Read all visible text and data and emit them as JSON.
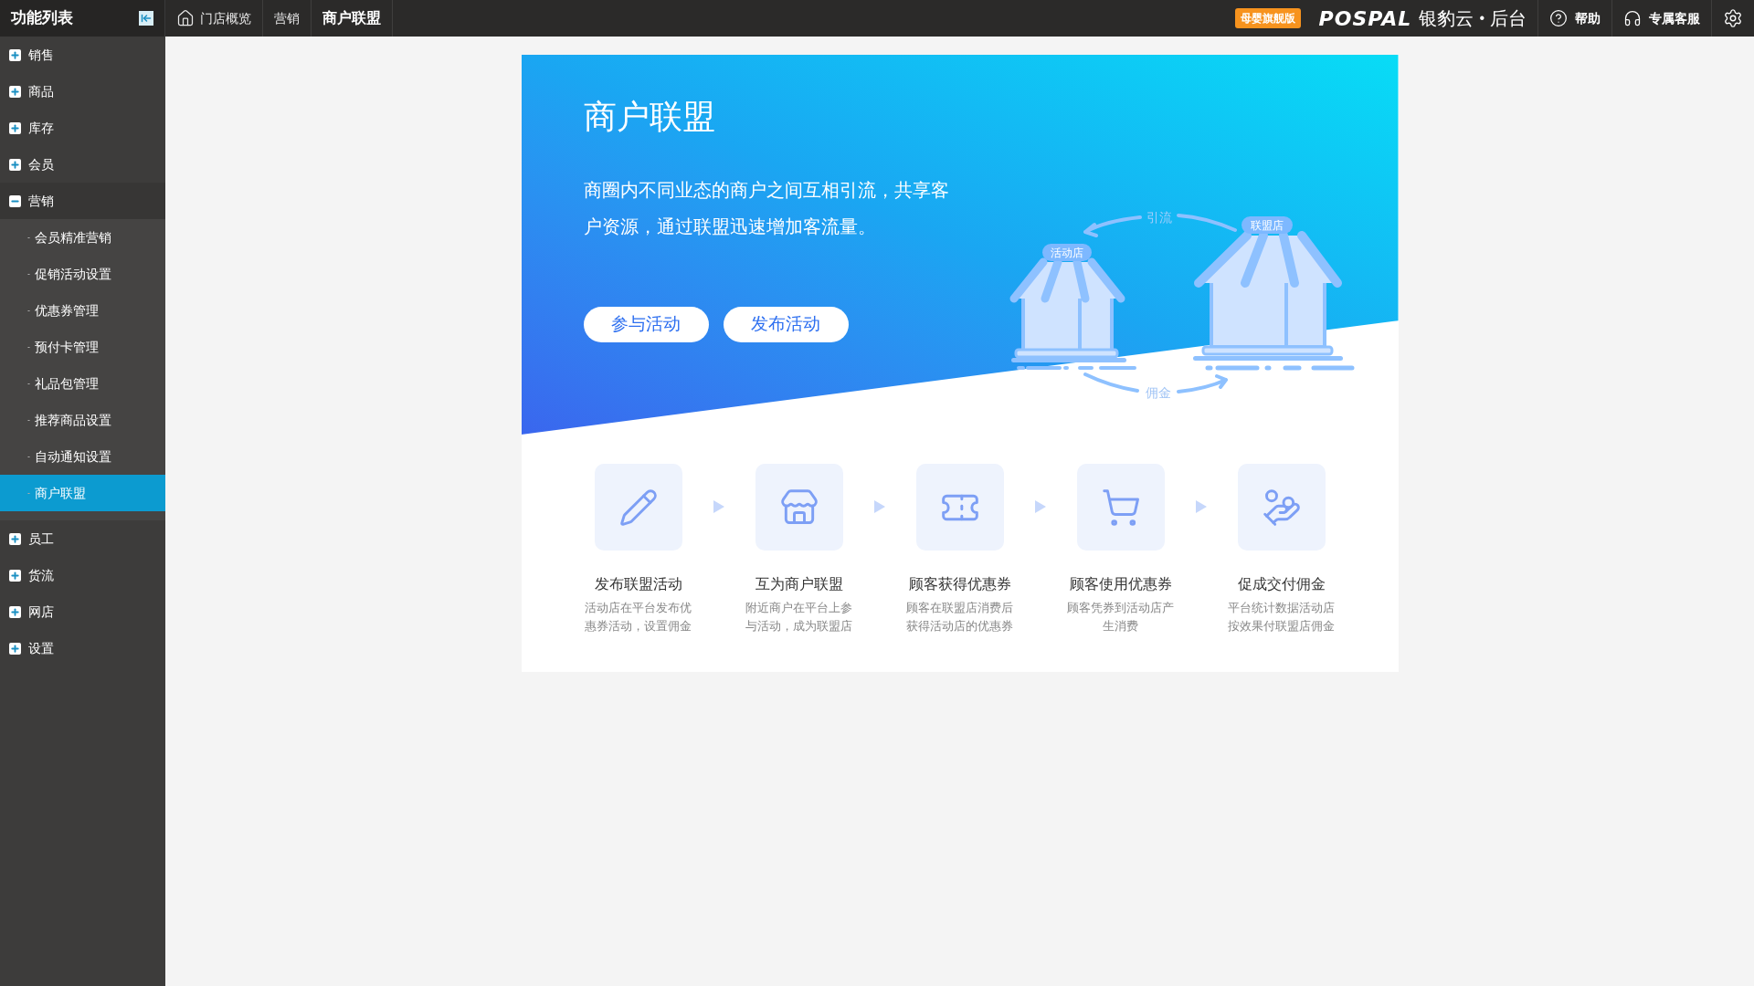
{
  "sidebar": {
    "title": "功能列表",
    "items": [
      {
        "label": "销售",
        "expanded": false
      },
      {
        "label": "商品",
        "expanded": false
      },
      {
        "label": "库存",
        "expanded": false
      },
      {
        "label": "会员",
        "expanded": false
      },
      {
        "label": "营销",
        "expanded": true,
        "children": [
          {
            "label": "会员精准营销",
            "selected": false
          },
          {
            "label": "促销活动设置",
            "selected": false
          },
          {
            "label": "优惠券管理",
            "selected": false
          },
          {
            "label": "预付卡管理",
            "selected": false
          },
          {
            "label": "礼品包管理",
            "selected": false
          },
          {
            "label": "推荐商品设置",
            "selected": false
          },
          {
            "label": "自动通知设置",
            "selected": false
          },
          {
            "label": "商户联盟",
            "selected": true
          }
        ]
      },
      {
        "label": "员工",
        "expanded": false
      },
      {
        "label": "货流",
        "expanded": false
      },
      {
        "label": "网店",
        "expanded": false
      },
      {
        "label": "设置",
        "expanded": false
      }
    ]
  },
  "topbar": {
    "breadcrumbs": [
      {
        "label": "门店概览",
        "kind": "home",
        "selected": false
      },
      {
        "label": "营销",
        "kind": "plain",
        "selected": false
      },
      {
        "label": "商户联盟",
        "kind": "plain",
        "selected": true
      }
    ],
    "edition_badge": "母婴旗舰版",
    "logo": "POSPAL",
    "brand": "银豹云",
    "brand_separator": "•",
    "brand_suffix": "后台",
    "actions": [
      {
        "label": "帮助",
        "kind": "help"
      },
      {
        "label": "专属客服",
        "kind": "service"
      }
    ]
  },
  "banner": {
    "title": "商户联盟",
    "description": "商圈内不同业态的商户之间互相引流，共享客户资源，通过联盟迅速增加客流量。",
    "buttons": [
      "参与活动",
      "发布活动"
    ],
    "illustration": {
      "active_store": "活动店",
      "alliance_store": "联盟店",
      "flow_top": "引流",
      "flow_bottom": "佣金"
    }
  },
  "steps": [
    {
      "kind": "pencil",
      "title": "发布联盟活动",
      "description": "活动店在平台发布优惠券活动，设置佣金"
    },
    {
      "kind": "stores",
      "title": "互为商户联盟",
      "description": "附近商户在平台上参与活动，成为联盟店"
    },
    {
      "kind": "ticket",
      "title": "顾客获得优惠券",
      "description": "顾客在联盟店消费后获得活动店的优惠券"
    },
    {
      "kind": "cart",
      "title": "顾客使用优惠券",
      "description": "顾客凭券到活动店产生消费"
    },
    {
      "kind": "coin",
      "title": "促成交付佣金",
      "description": "平台统计数据活动店按效果付联盟店佣金"
    }
  ]
}
